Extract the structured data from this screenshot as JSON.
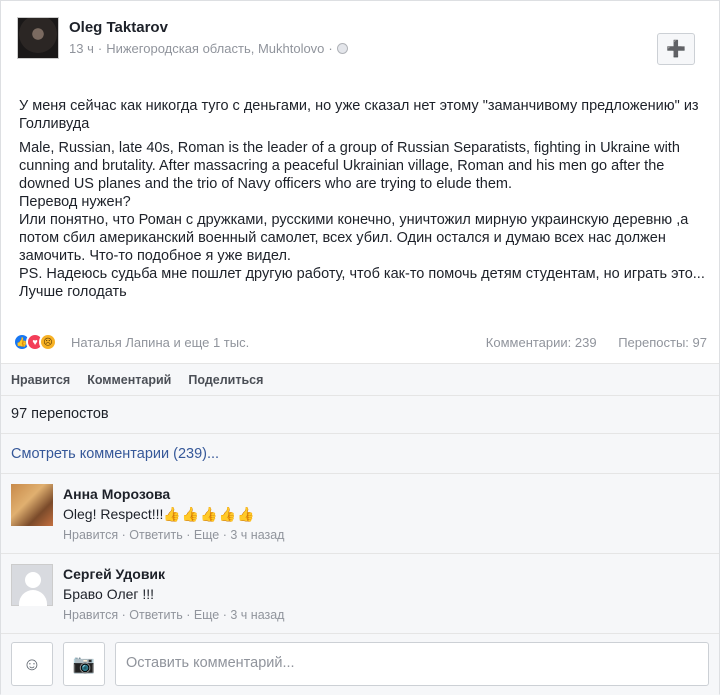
{
  "post": {
    "author": "Oleg Taktarov",
    "time": "13 ч",
    "location": "Нижегородская область, Mukhtolovo",
    "paragraphs": [
      "У меня сейчас как никогда туго с деньгами, но уже сказал нет этому \"заманчивому предложению\" из Голливуда",
      "Male, Russian, late 40s, Roman is the leader of a group of Russian Separatists, fighting in Ukraine with cunning and brutality. After massacring a peaceful Ukrainian village, Roman and his men go after the downed US planes and the trio of Navy officers who are trying to elude them.",
      "Перевод нужен?",
      "Или понятно, что Роман с дружками, русскими конечно, уничтожил мирную украинскую деревню ,а потом сбил американский военный самолет, всех убил. Один остался и думаю всех нас должен замочить. Что-то подобное я уже видел.",
      "PS. Надеюсь судьба мне пошлет другую работу, чтоб как-то помочь детям студентам, но играть это... Лучше голодать"
    ]
  },
  "reactions": {
    "names": "Наталья Лапина и еще 1 тыс.",
    "comments": "Комментарии: 239",
    "shares": "Перепосты: 97"
  },
  "actions": {
    "like": "Нравится",
    "comment": "Комментарий",
    "share": "Поделиться"
  },
  "shares_count": "97 перепостов",
  "view_comments": "Смотреть комментарии (239)...",
  "comments": [
    {
      "name": "Анна Морозова",
      "text": "Oleg! Respect!!!",
      "emoji": "👍👍👍👍👍",
      "like": "Нравится",
      "reply": "Ответить",
      "more": "Еще",
      "time": "3 ч назад"
    },
    {
      "name": "Сергей Удовик",
      "text": "Браво Олег !!!",
      "like": "Нравится",
      "reply": "Ответить",
      "more": "Еще",
      "time": "3 ч назад"
    }
  ],
  "compose": {
    "placeholder": "Оставить комментарий..."
  }
}
